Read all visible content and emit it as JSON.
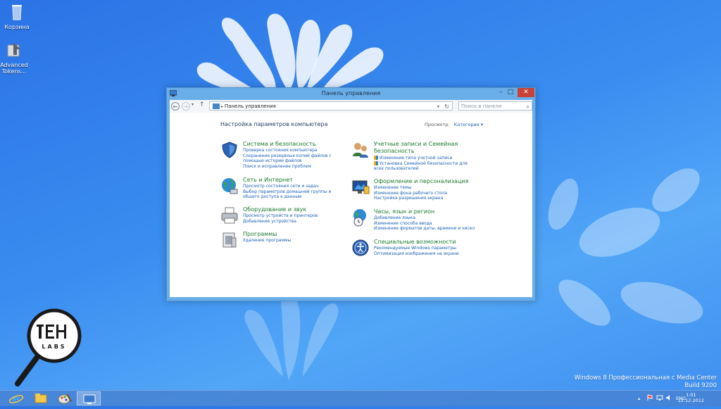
{
  "desktop": {
    "icons": [
      {
        "label": "Корзина",
        "icon": "recycle-bin-icon"
      },
      {
        "label": "Advanced Tokens...",
        "icon": "advanced-tokens-icon"
      }
    ],
    "watermark": {
      "line1": "Windows 8 Профессиональная с Media Center",
      "line2": "Build 9200"
    },
    "logo_text": "TECH LABS"
  },
  "window": {
    "title": "Панель управления",
    "controls": {
      "minimize": "–",
      "maximize": "□",
      "close": "✕"
    },
    "address": {
      "breadcrumb": "Панель управления",
      "search_placeholder": "Поиск в панели управления"
    },
    "heading": "Настройка параметров компьютера",
    "view_label": "Просмотр:",
    "view_value": "Категория",
    "categories_left": [
      {
        "title": "Система и безопасность",
        "icon": "shield-icon",
        "links": [
          "Проверка состояния компьютера",
          "Сохранение резервных копий файлов с помощью истории файлов",
          "Поиск и исправление проблем"
        ]
      },
      {
        "title": "Сеть и Интернет",
        "icon": "network-globe-icon",
        "links": [
          "Просмотр состояния сети и задач",
          "Выбор параметров домашней группы и общего доступа к данным"
        ]
      },
      {
        "title": "Оборудование и звук",
        "icon": "printer-icon",
        "links": [
          "Просмотр устройств и принтеров",
          "Добавление устройства"
        ]
      },
      {
        "title": "Программы",
        "icon": "programs-icon",
        "links": [
          "Удаление программы"
        ]
      }
    ],
    "categories_right": [
      {
        "title": "Учетные записи и Семейная безопасность",
        "icon": "users-icon",
        "links": [
          "Изменение типа учетной записи",
          "Установка Семейной безопасности для всех пользователей"
        ]
      },
      {
        "title": "Оформление и персонализация",
        "icon": "monitor-icon",
        "links": [
          "Изменение темы",
          "Изменение фона рабочего стола",
          "Настройка разрешения экрана"
        ]
      },
      {
        "title": "Часы, язык и регион",
        "icon": "clock-globe-icon",
        "links": [
          "Добавление языка",
          "Изменение способа ввода",
          "Изменение форматов даты, времени и чисел"
        ]
      },
      {
        "title": "Специальные возможности",
        "icon": "accessibility-icon",
        "links": [
          "Рекомендуемые Windows параметры",
          "Оптимизация изображения на экране"
        ]
      }
    ]
  },
  "taskbar": {
    "apps": [
      "internet-explorer-icon",
      "file-explorer-icon",
      "paint-icon",
      "control-panel-icon"
    ],
    "language": "ENG",
    "time": "1:01",
    "date": "12.12.2012"
  }
}
